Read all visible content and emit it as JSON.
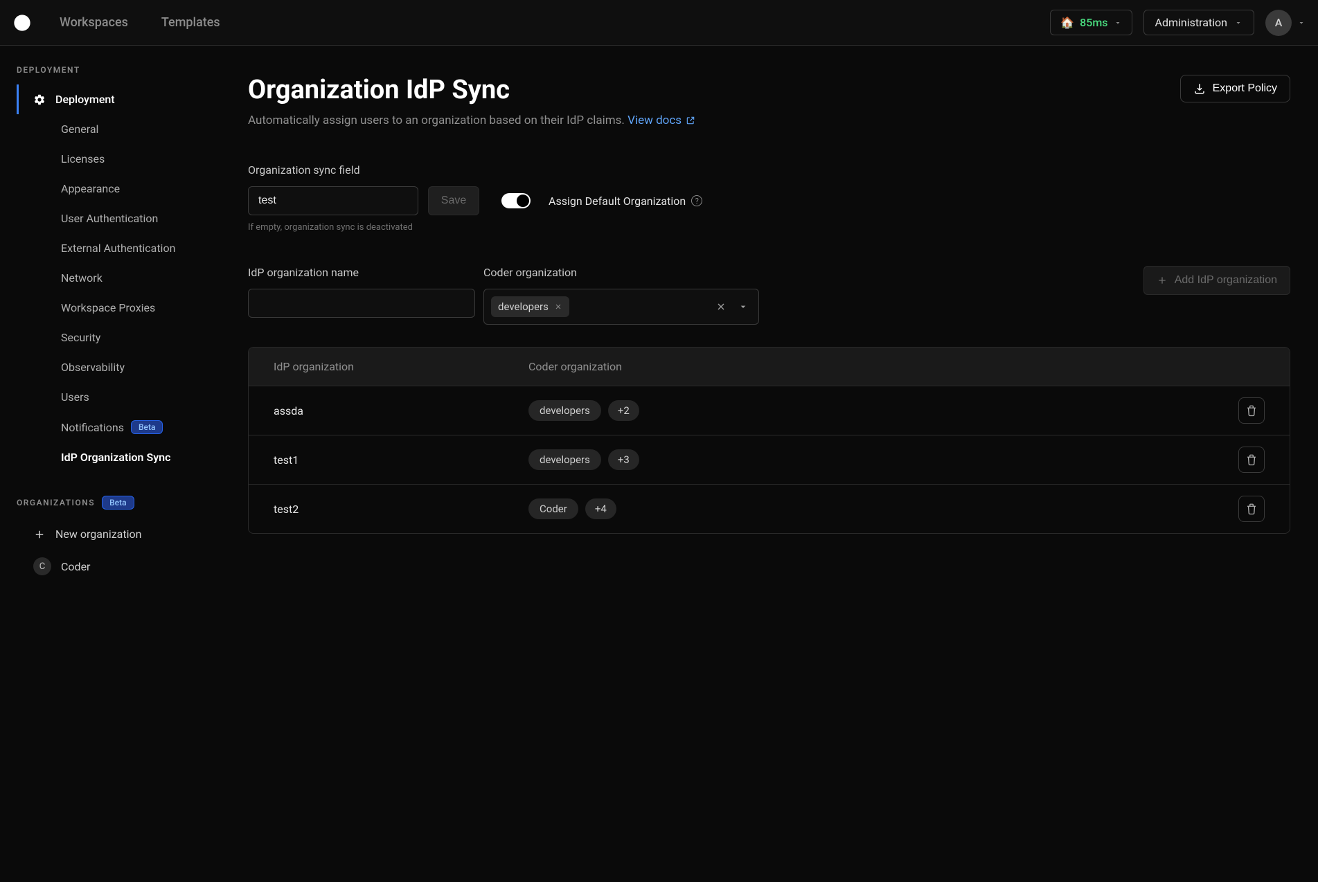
{
  "nav": {
    "workspaces": "Workspaces",
    "templates": "Templates",
    "latency": "85ms",
    "administration": "Administration",
    "avatar_letter": "A"
  },
  "sidebar": {
    "deployment_section": "DEPLOYMENT",
    "deployment_item": "Deployment",
    "links": {
      "general": "General",
      "licenses": "Licenses",
      "appearance": "Appearance",
      "user_auth": "User Authentication",
      "external_auth": "External Authentication",
      "network": "Network",
      "workspace_proxies": "Workspace Proxies",
      "security": "Security",
      "observability": "Observability",
      "users": "Users",
      "notifications": "Notifications",
      "notifications_badge": "Beta",
      "idp_org_sync": "IdP Organization Sync"
    },
    "organizations_section": "ORGANIZATIONS",
    "organizations_badge": "Beta",
    "new_organization": "New organization",
    "org_item_letter": "C",
    "org_item_name": "Coder"
  },
  "main": {
    "title": "Organization IdP Sync",
    "subtitle": "Automatically assign users to an organization based on their IdP claims.",
    "view_docs": "View docs",
    "export_policy": "Export Policy",
    "sync_field_label": "Organization sync field",
    "sync_field_value": "test",
    "save_btn": "Save",
    "sync_field_hint": "If empty, organization sync is deactivated",
    "assign_default_toggle": "Assign Default Organization",
    "idp_org_name_label": "IdP organization name",
    "coder_org_label": "Coder organization",
    "selected_org_chip": "developers",
    "add_idp_org_btn": "Add IdP organization"
  },
  "table": {
    "col1": "IdP organization",
    "col2": "Coder organization",
    "rows": [
      {
        "idp": "assda",
        "org": "developers",
        "extra": "+2"
      },
      {
        "idp": "test1",
        "org": "developers",
        "extra": "+3"
      },
      {
        "idp": "test2",
        "org": "Coder",
        "extra": "+4"
      }
    ]
  }
}
